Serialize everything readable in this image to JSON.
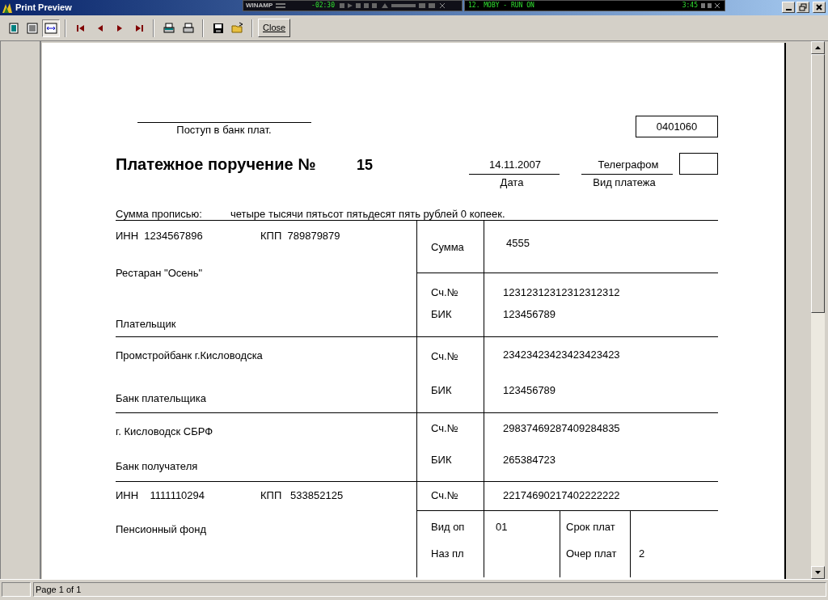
{
  "window": {
    "title": "Print Preview"
  },
  "winamp": {
    "title": "WINAMP",
    "time": "-02:30",
    "track": "12. MOBY - RUN ON",
    "duration": "3:45"
  },
  "toolbar": {
    "view_buttons": [
      {
        "selected": false
      },
      {
        "selected": false
      },
      {
        "selected": true
      }
    ],
    "close": "Close"
  },
  "document": {
    "received_label": "Поступ в банк плат.",
    "form_code": "0401060",
    "title": "Платежное поручение №",
    "number": "15",
    "date": "14.11.2007",
    "date_label": "Дата",
    "payment_type": "Телеграфом",
    "payment_type_label": "Вид платежа",
    "amount_words_label": "Сумма прописью:",
    "amount_words": "четыре тысячи пятьсот пятьдесят пять рублей 0 копеек.",
    "payer": {
      "inn": "ИНН  1234567896",
      "kpp": "КПП  789879879",
      "name": "Рестаран \"Осень\"",
      "label": "Плательщик",
      "amount_label": "Сумма",
      "amount": "4555",
      "account_label": "Сч.№",
      "account": "12312312312312312312",
      "bik_label": "БИК",
      "bik": "123456789"
    },
    "payer_bank": {
      "name": "Промстройбанк г.Кисловодска",
      "label": "Банк плательщика",
      "account_label": "Сч.№",
      "account": "23423423423423423423",
      "bik_label": "БИК",
      "bik": "123456789"
    },
    "payee_bank": {
      "name": "г. Кисловодск СБРФ",
      "label": "Банк получателя",
      "account_label": "Сч.№",
      "account": "29837469287409284835",
      "bik_label": "БИК",
      "bik": "265384723"
    },
    "payee": {
      "inn": "ИНН    1111110294",
      "kpp": "КПП   533852125",
      "name": "Пенсионный фонд",
      "account_label": "Сч.№",
      "account": "22174690217402222222"
    },
    "details": {
      "op_type_label": "Вид оп",
      "op_type": "01",
      "purpose_label": "Наз пл",
      "term_label": "Срок плат",
      "order_label": "Очер плат",
      "order": "2"
    }
  },
  "status_bar": {
    "page": "Page 1 of 1"
  }
}
